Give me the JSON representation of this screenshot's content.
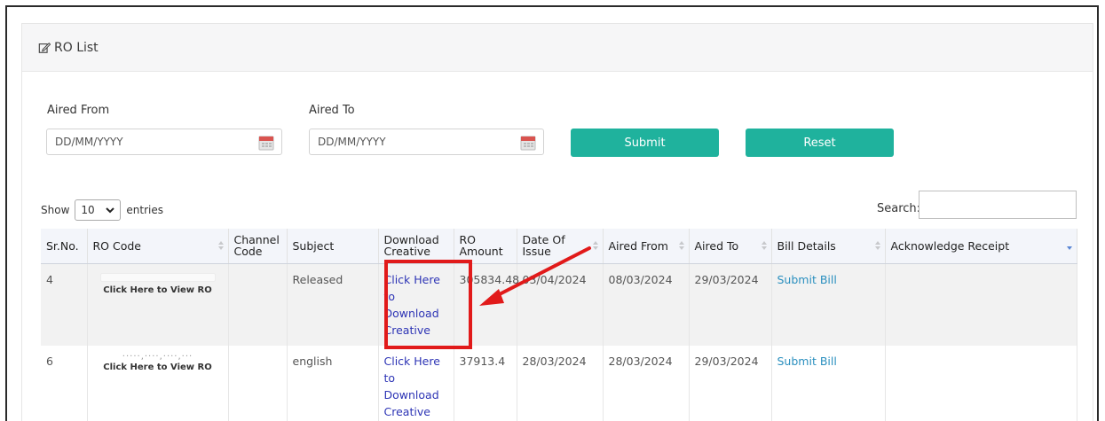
{
  "panel": {
    "title": "RO List"
  },
  "filters": {
    "aired_from_label": "Aired From",
    "aired_from_placeholder": "DD/MM/YYYY",
    "aired_to_label": "Aired To",
    "aired_to_placeholder": "DD/MM/YYYY",
    "submit_label": "Submit",
    "reset_label": "Reset"
  },
  "datatable": {
    "show_label": "Show",
    "entries_value": "10",
    "entries_label": "entries",
    "search_label": "Search:"
  },
  "table": {
    "headers": [
      "Sr.No.",
      "RO Code",
      "Channel Code",
      "Subject",
      "Download Creative",
      "RO Amount",
      "Date Of Issue",
      "Aired From",
      "Aired To",
      "Bill Details",
      "Acknowledge Receipt"
    ],
    "rows": [
      {
        "sr": "4",
        "ro_code_link": "Click Here to View RO",
        "channel_code": "",
        "subject": "Released",
        "download": "Click Here to Download Creative",
        "amount": "305834.48",
        "date_issue": "03/04/2024",
        "aired_from": "08/03/2024",
        "aired_to": "29/03/2024",
        "bill": "Submit Bill",
        "ack": ""
      },
      {
        "sr": "6",
        "ro_code_link": "Click Here to View RO",
        "channel_code": "",
        "subject": "english",
        "download": "Click Here to Download Creative",
        "amount": "37913.4",
        "date_issue": "28/03/2024",
        "aired_from": "28/03/2024",
        "aired_to": "29/03/2024",
        "bill": "Submit Bill",
        "ack": ""
      }
    ]
  },
  "colors": {
    "accent": "#1fb29d",
    "link": "#2d34b5",
    "annotation": "#e11a1a"
  },
  "icons": [
    "edit-icon",
    "calendar-icon",
    "chevron-down-icon",
    "sort-icon"
  ]
}
